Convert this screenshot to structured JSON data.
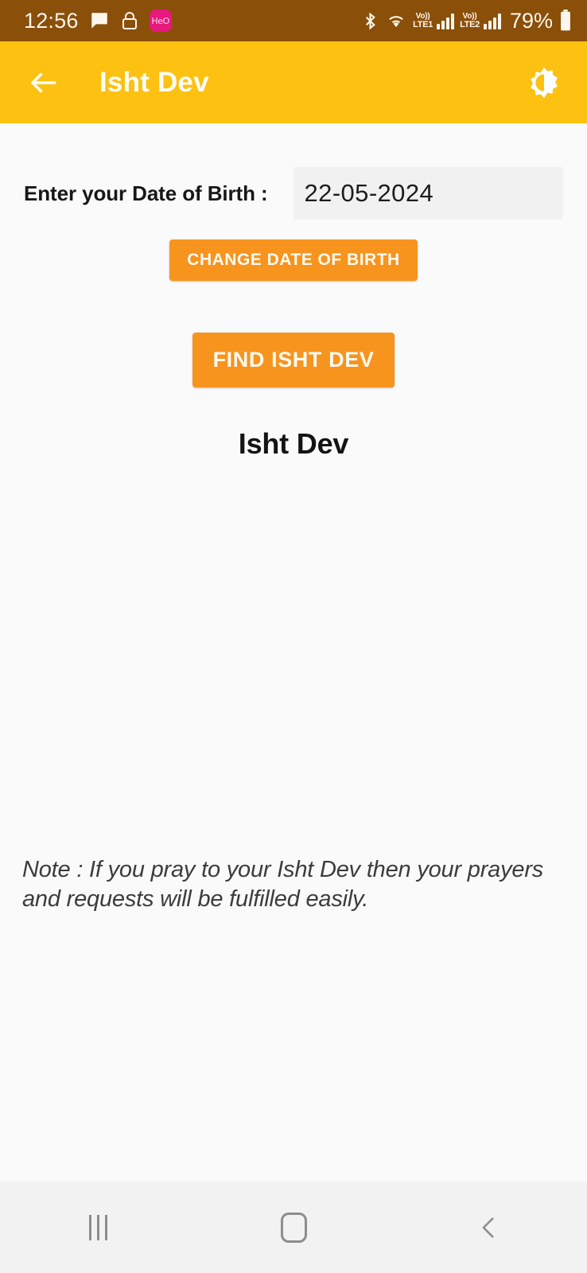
{
  "status_bar": {
    "time": "12:56",
    "battery_percent": "79%",
    "icons": [
      "message-icon",
      "lock-icon",
      "hero-app-badge-icon",
      "bluetooth-icon",
      "wifi-icon",
      "volte1-icon",
      "signal-bars-sim1-icon",
      "volte2-icon",
      "signal-bars-sim2-icon",
      "battery-icon"
    ],
    "hero_badge_label": "HeO",
    "volte1_top": "Vo))",
    "volte1_bottom": "LTE1",
    "volte2_top": "Vo))",
    "volte2_bottom": "LTE2",
    "background_color": "#8a4f09"
  },
  "app_bar": {
    "title": "Isht Dev",
    "back_icon": "arrow-left-icon",
    "theme_toggle_icon": "brightness-toggle-icon",
    "background_color": "#fcc111"
  },
  "main": {
    "dob_label": "Enter your Date of Birth :",
    "dob_value": "22-05-2024",
    "change_dob_button": "CHANGE DATE OF BIRTH",
    "find_button": "FIND ISHT DEV",
    "result_heading": "Isht Dev",
    "note": "Note : If you pray to your Isht Dev then your prayers and requests will be fulfilled easily.",
    "accent_color": "#f7941e",
    "background_color": "#fafafa"
  },
  "nav_bar": {
    "recents_icon": "recents-icon",
    "home_icon": "home-icon",
    "back_icon": "back-chevron-icon",
    "background_color": "#f2f2f2"
  }
}
